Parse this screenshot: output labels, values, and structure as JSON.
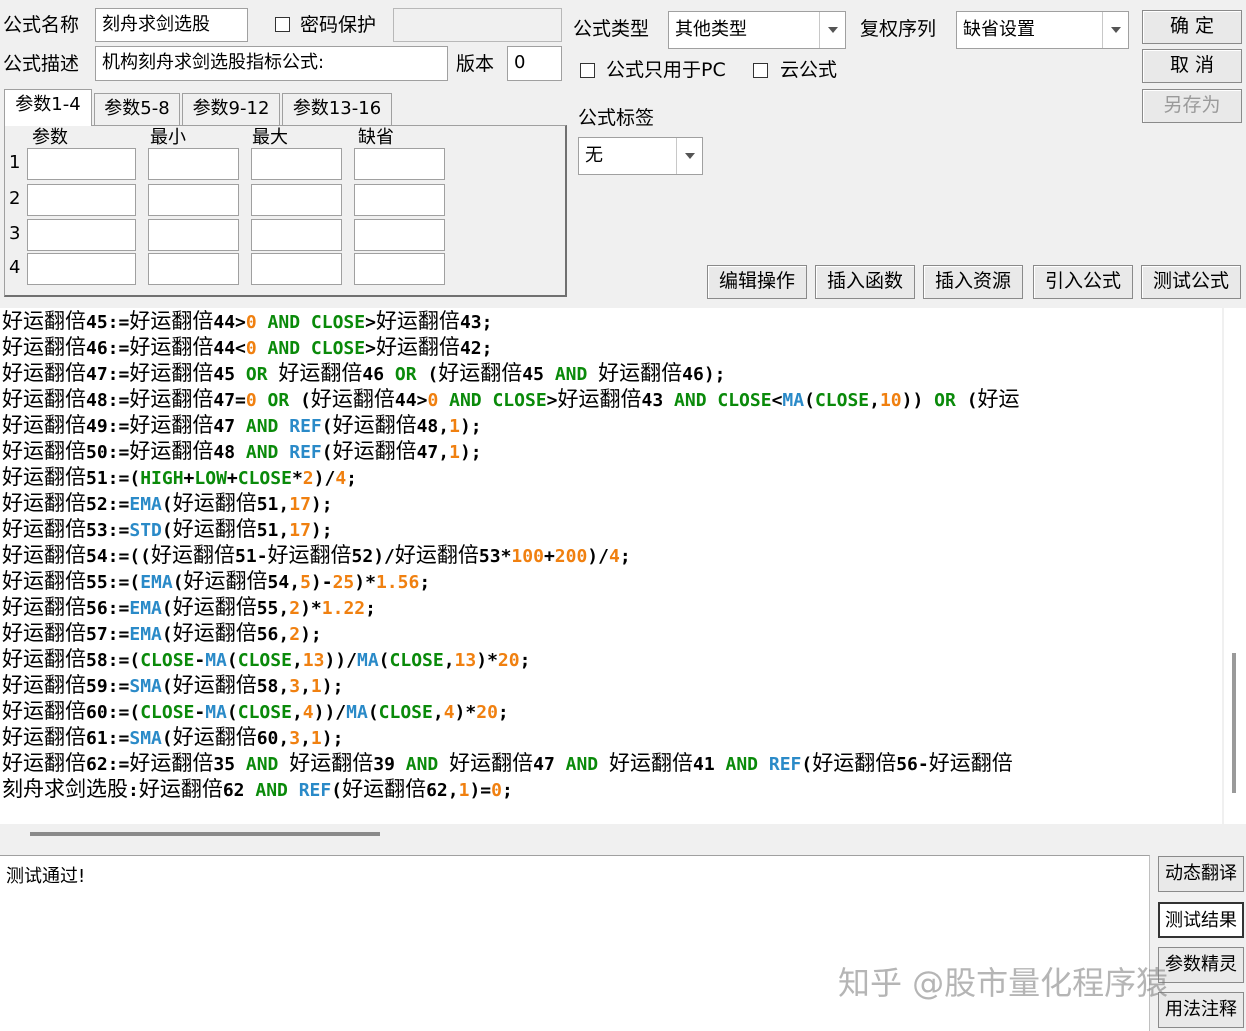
{
  "header": {
    "name_label": "公式名称",
    "name_value": "刻舟求剑选股",
    "password_label": "密码保护",
    "password_value": "",
    "desc_label": "公式描述",
    "desc_value": "机构刻舟求剑选股指标公式:",
    "version_label": "版本",
    "version_value": "0",
    "type_label": "公式类型",
    "type_value": "其他类型",
    "restore_label": "复权序列",
    "restore_value": "缺省设置",
    "pc_only_label": "公式只用于PC",
    "cloud_label": "云公式",
    "tag_label": "公式标签",
    "tag_value": "无"
  },
  "buttons": {
    "ok": "确 定",
    "cancel": "取 消",
    "save_as": "另存为",
    "edit_ops": "编辑操作",
    "insert_func": "插入函数",
    "insert_res": "插入资源",
    "import_formula": "引入公式",
    "test_formula": "测试公式"
  },
  "param_tabs": [
    "参数1-4",
    "参数5-8",
    "参数9-12",
    "参数13-16"
  ],
  "param_columns": [
    "参数",
    "最小",
    "最大",
    "缺省"
  ],
  "param_rows": [
    "1",
    "2",
    "3",
    "4"
  ],
  "code_lines": [
    [
      [
        "c",
        "好运翻倍"
      ],
      [
        "o",
        "45:=",
        0
      ],
      [
        "c",
        "好运翻倍"
      ],
      [
        "o",
        "44>"
      ],
      [
        "n",
        "0"
      ],
      [
        "k",
        " AND CLOSE"
      ],
      [
        "o",
        ">"
      ],
      [
        "c",
        "好运翻倍"
      ],
      [
        "o",
        "43;"
      ]
    ],
    [
      [
        "c",
        "好运翻倍"
      ],
      [
        "o",
        "46:="
      ],
      [
        "c",
        "好运翻倍"
      ],
      [
        "o",
        "44<"
      ],
      [
        "n",
        "0"
      ],
      [
        "k",
        " AND CLOSE"
      ],
      [
        "o",
        ">"
      ],
      [
        "c",
        "好运翻倍"
      ],
      [
        "o",
        "42;"
      ]
    ],
    [
      [
        "c",
        "好运翻倍"
      ],
      [
        "o",
        "47:="
      ],
      [
        "c",
        "好运翻倍"
      ],
      [
        "o",
        "45"
      ],
      [
        "k",
        " OR "
      ],
      [
        "c",
        "好运翻倍"
      ],
      [
        "o",
        "46"
      ],
      [
        "k",
        " OR "
      ],
      [
        "o",
        "("
      ],
      [
        "c",
        "好运翻倍"
      ],
      [
        "o",
        "45"
      ],
      [
        "k",
        " AND "
      ],
      [
        "c",
        "好运翻倍"
      ],
      [
        "o",
        "46);"
      ]
    ],
    [
      [
        "c",
        "好运翻倍"
      ],
      [
        "o",
        "48:="
      ],
      [
        "c",
        "好运翻倍"
      ],
      [
        "o",
        "47="
      ],
      [
        "n",
        "0"
      ],
      [
        "k",
        " OR "
      ],
      [
        "o",
        "("
      ],
      [
        "c",
        "好运翻倍"
      ],
      [
        "o",
        "44>"
      ],
      [
        "n",
        "0"
      ],
      [
        "k",
        " AND CLOSE"
      ],
      [
        "o",
        ">"
      ],
      [
        "c",
        "好运翻倍"
      ],
      [
        "o",
        "43"
      ],
      [
        "k",
        " AND CLOSE"
      ],
      [
        "o",
        "<"
      ],
      [
        "f",
        "MA"
      ],
      [
        "o",
        "("
      ],
      [
        "k",
        "CLOSE"
      ],
      [
        "o",
        ","
      ],
      [
        "n",
        "10"
      ],
      [
        "o",
        "))"
      ],
      [
        "k",
        " OR "
      ],
      [
        "o",
        "("
      ],
      [
        "c",
        "好运"
      ]
    ],
    [
      [
        "c",
        "好运翻倍"
      ],
      [
        "o",
        "49:="
      ],
      [
        "c",
        "好运翻倍"
      ],
      [
        "o",
        "47"
      ],
      [
        "k",
        " AND "
      ],
      [
        "f",
        "REF"
      ],
      [
        "o",
        "("
      ],
      [
        "c",
        "好运翻倍"
      ],
      [
        "o",
        "48,"
      ],
      [
        "n",
        "1"
      ],
      [
        "o",
        ");"
      ]
    ],
    [
      [
        "c",
        "好运翻倍"
      ],
      [
        "o",
        "50:="
      ],
      [
        "c",
        "好运翻倍"
      ],
      [
        "o",
        "48"
      ],
      [
        "k",
        " AND "
      ],
      [
        "f",
        "REF"
      ],
      [
        "o",
        "("
      ],
      [
        "c",
        "好运翻倍"
      ],
      [
        "o",
        "47,"
      ],
      [
        "n",
        "1"
      ],
      [
        "o",
        ");"
      ]
    ],
    [
      [
        "c",
        "好运翻倍"
      ],
      [
        "o",
        "51:=("
      ],
      [
        "k",
        "HIGH"
      ],
      [
        "o",
        "+"
      ],
      [
        "k",
        "LOW"
      ],
      [
        "o",
        "+"
      ],
      [
        "k",
        "CLOSE"
      ],
      [
        "o",
        "*"
      ],
      [
        "n",
        "2"
      ],
      [
        "o",
        ")/"
      ],
      [
        "n",
        "4"
      ],
      [
        "o",
        ";"
      ]
    ],
    [
      [
        "c",
        "好运翻倍"
      ],
      [
        "o",
        "52:="
      ],
      [
        "f",
        "EMA"
      ],
      [
        "o",
        "("
      ],
      [
        "c",
        "好运翻倍"
      ],
      [
        "o",
        "51,"
      ],
      [
        "n",
        "17"
      ],
      [
        "o",
        ");"
      ]
    ],
    [
      [
        "c",
        "好运翻倍"
      ],
      [
        "o",
        "53:="
      ],
      [
        "f",
        "STD"
      ],
      [
        "o",
        "("
      ],
      [
        "c",
        "好运翻倍"
      ],
      [
        "o",
        "51,"
      ],
      [
        "n",
        "17"
      ],
      [
        "o",
        ");"
      ]
    ],
    [
      [
        "c",
        "好运翻倍"
      ],
      [
        "o",
        "54:=(("
      ],
      [
        "c",
        "好运翻倍"
      ],
      [
        "o",
        "51-"
      ],
      [
        "c",
        "好运翻倍"
      ],
      [
        "o",
        "52)/"
      ],
      [
        "c",
        "好运翻倍"
      ],
      [
        "o",
        "53*"
      ],
      [
        "n",
        "100"
      ],
      [
        "o",
        "+"
      ],
      [
        "n",
        "200"
      ],
      [
        "o",
        ")/"
      ],
      [
        "n",
        "4"
      ],
      [
        "o",
        ";"
      ]
    ],
    [
      [
        "c",
        "好运翻倍"
      ],
      [
        "o",
        "55:=("
      ],
      [
        "f",
        "EMA"
      ],
      [
        "o",
        "("
      ],
      [
        "c",
        "好运翻倍"
      ],
      [
        "o",
        "54,"
      ],
      [
        "n",
        "5"
      ],
      [
        "o",
        ")-"
      ],
      [
        "n",
        "25"
      ],
      [
        "o",
        ")*"
      ],
      [
        "n",
        "1.56"
      ],
      [
        "o",
        ";"
      ]
    ],
    [
      [
        "c",
        "好运翻倍"
      ],
      [
        "o",
        "56:="
      ],
      [
        "f",
        "EMA"
      ],
      [
        "o",
        "("
      ],
      [
        "c",
        "好运翻倍"
      ],
      [
        "o",
        "55,"
      ],
      [
        "n",
        "2"
      ],
      [
        "o",
        ")*"
      ],
      [
        "n",
        "1.22"
      ],
      [
        "o",
        ";"
      ]
    ],
    [
      [
        "c",
        "好运翻倍"
      ],
      [
        "o",
        "57:="
      ],
      [
        "f",
        "EMA"
      ],
      [
        "o",
        "("
      ],
      [
        "c",
        "好运翻倍"
      ],
      [
        "o",
        "56,"
      ],
      [
        "n",
        "2"
      ],
      [
        "o",
        ");"
      ]
    ],
    [
      [
        "c",
        "好运翻倍"
      ],
      [
        "o",
        "58:=("
      ],
      [
        "k",
        "CLOSE"
      ],
      [
        "o",
        "-"
      ],
      [
        "f",
        "MA"
      ],
      [
        "o",
        "("
      ],
      [
        "k",
        "CLOSE"
      ],
      [
        "o",
        ","
      ],
      [
        "n",
        "13"
      ],
      [
        "o",
        "))/"
      ],
      [
        "f",
        "MA"
      ],
      [
        "o",
        "("
      ],
      [
        "k",
        "CLOSE"
      ],
      [
        "o",
        ","
      ],
      [
        "n",
        "13"
      ],
      [
        "o",
        ")*"
      ],
      [
        "n",
        "20"
      ],
      [
        "o",
        ";"
      ]
    ],
    [
      [
        "c",
        "好运翻倍"
      ],
      [
        "o",
        "59:="
      ],
      [
        "f",
        "SMA"
      ],
      [
        "o",
        "("
      ],
      [
        "c",
        "好运翻倍"
      ],
      [
        "o",
        "58,"
      ],
      [
        "n",
        "3"
      ],
      [
        "o",
        ","
      ],
      [
        "n",
        "1"
      ],
      [
        "o",
        ");"
      ]
    ],
    [
      [
        "c",
        "好运翻倍"
      ],
      [
        "o",
        "60:=("
      ],
      [
        "k",
        "CLOSE"
      ],
      [
        "o",
        "-"
      ],
      [
        "f",
        "MA"
      ],
      [
        "o",
        "("
      ],
      [
        "k",
        "CLOSE"
      ],
      [
        "o",
        ","
      ],
      [
        "n",
        "4"
      ],
      [
        "o",
        "))/"
      ],
      [
        "f",
        "MA"
      ],
      [
        "o",
        "("
      ],
      [
        "k",
        "CLOSE"
      ],
      [
        "o",
        ","
      ],
      [
        "n",
        "4"
      ],
      [
        "o",
        ")*"
      ],
      [
        "n",
        "20"
      ],
      [
        "o",
        ";"
      ]
    ],
    [
      [
        "c",
        "好运翻倍"
      ],
      [
        "o",
        "61:="
      ],
      [
        "f",
        "SMA"
      ],
      [
        "o",
        "("
      ],
      [
        "c",
        "好运翻倍"
      ],
      [
        "o",
        "60,"
      ],
      [
        "n",
        "3"
      ],
      [
        "o",
        ","
      ],
      [
        "n",
        "1"
      ],
      [
        "o",
        ");"
      ]
    ],
    [
      [
        "c",
        "好运翻倍"
      ],
      [
        "o",
        "62:="
      ],
      [
        "c",
        "好运翻倍"
      ],
      [
        "o",
        "35"
      ],
      [
        "k",
        " AND "
      ],
      [
        "c",
        "好运翻倍"
      ],
      [
        "o",
        "39"
      ],
      [
        "k",
        " AND "
      ],
      [
        "c",
        "好运翻倍"
      ],
      [
        "o",
        "47"
      ],
      [
        "k",
        " AND "
      ],
      [
        "c",
        "好运翻倍"
      ],
      [
        "o",
        "41"
      ],
      [
        "k",
        " AND "
      ],
      [
        "f",
        "REF"
      ],
      [
        "o",
        "("
      ],
      [
        "c",
        "好运翻倍"
      ],
      [
        "o",
        "56-"
      ],
      [
        "c",
        "好运翻倍"
      ]
    ],
    [
      [
        "c",
        "刻舟求剑选股"
      ],
      [
        "o",
        ":"
      ],
      [
        "c",
        "好运翻倍"
      ],
      [
        "o",
        "62"
      ],
      [
        "k",
        " AND "
      ],
      [
        "f",
        "REF"
      ],
      [
        "o",
        "("
      ],
      [
        "c",
        "好运翻倍"
      ],
      [
        "o",
        "62,"
      ],
      [
        "n",
        "1"
      ],
      [
        "o",
        ")="
      ],
      [
        "n",
        "0"
      ],
      [
        "o",
        ";"
      ]
    ]
  ],
  "output_text": "测试通过!",
  "side_buttons": [
    "动态翻译",
    "测试结果",
    "参数精灵",
    "用法注释"
  ],
  "watermark": "知乎 @股市量化程序猿"
}
